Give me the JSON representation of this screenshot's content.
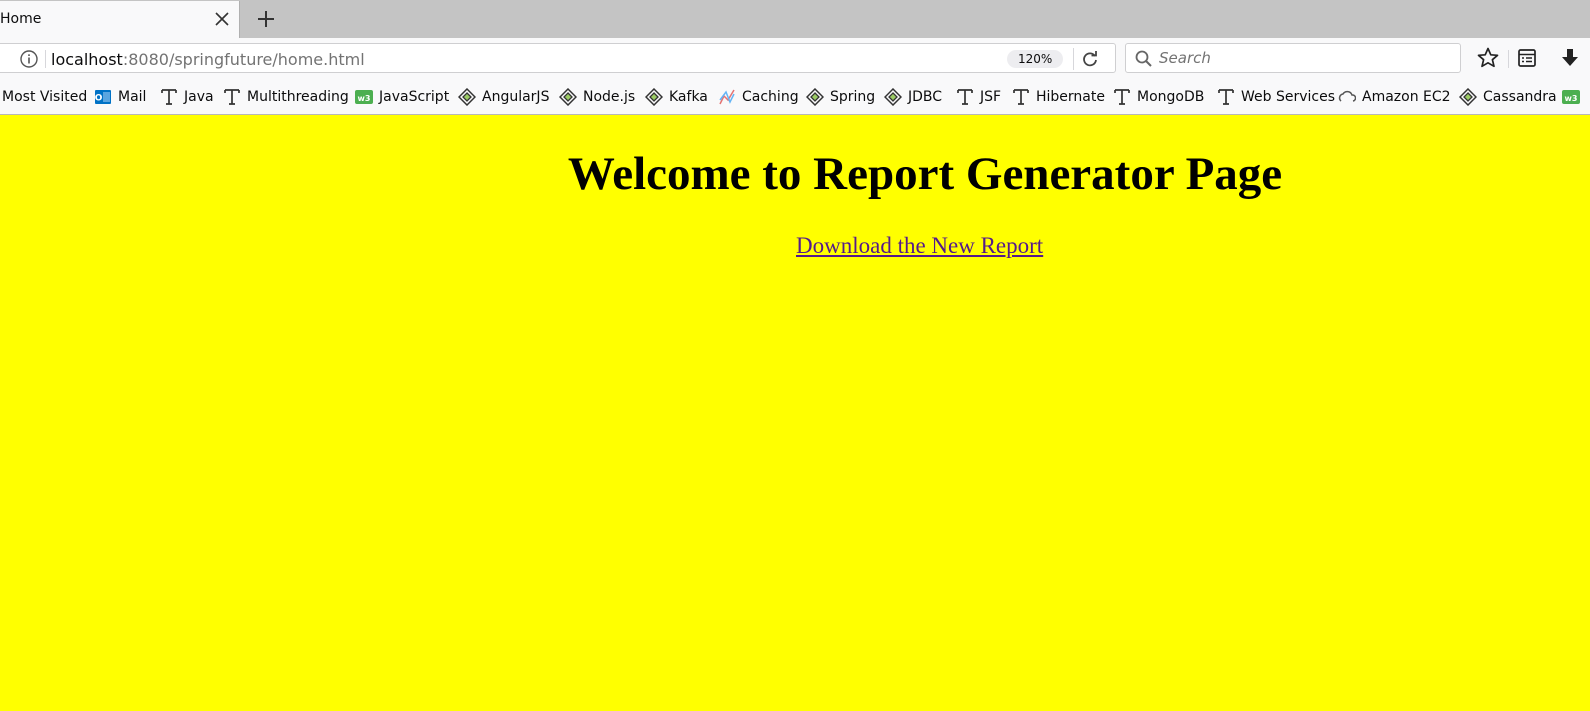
{
  "browser": {
    "tab": {
      "title": "Home"
    },
    "address": {
      "host": "localhost",
      "rest": ":8080/springfuture/home.html"
    },
    "zoom": "120%",
    "search": {
      "placeholder": "Search"
    }
  },
  "bookmarks": [
    {
      "label": "Most Visited",
      "icon": "none"
    },
    {
      "label": "Mail",
      "icon": "outlook-icon"
    },
    {
      "label": "Java",
      "icon": "t-icon"
    },
    {
      "label": "Multithreading",
      "icon": "t-icon"
    },
    {
      "label": "JavaScript",
      "icon": "w3-icon"
    },
    {
      "label": "AngularJS",
      "icon": "diamond-icon"
    },
    {
      "label": "Node.js",
      "icon": "diamond-icon"
    },
    {
      "label": "Kafka",
      "icon": "diamond-icon"
    },
    {
      "label": "Caching",
      "icon": "chart-icon"
    },
    {
      "label": "Spring",
      "icon": "diamond-icon"
    },
    {
      "label": "JDBC",
      "icon": "diamond-icon"
    },
    {
      "label": "JSF",
      "icon": "t-icon"
    },
    {
      "label": "Hibernate",
      "icon": "t-icon"
    },
    {
      "label": "MongoDB",
      "icon": "t-icon"
    },
    {
      "label": "Web Services",
      "icon": "t-icon"
    },
    {
      "label": "Amazon EC2",
      "icon": "cloud-icon"
    },
    {
      "label": "Cassandra",
      "icon": "diamond-icon"
    }
  ],
  "page": {
    "title": "Welcome to Report Generator Page",
    "link": "Download the New Report",
    "background": "#ffff00",
    "link_color": "#551a8b"
  }
}
